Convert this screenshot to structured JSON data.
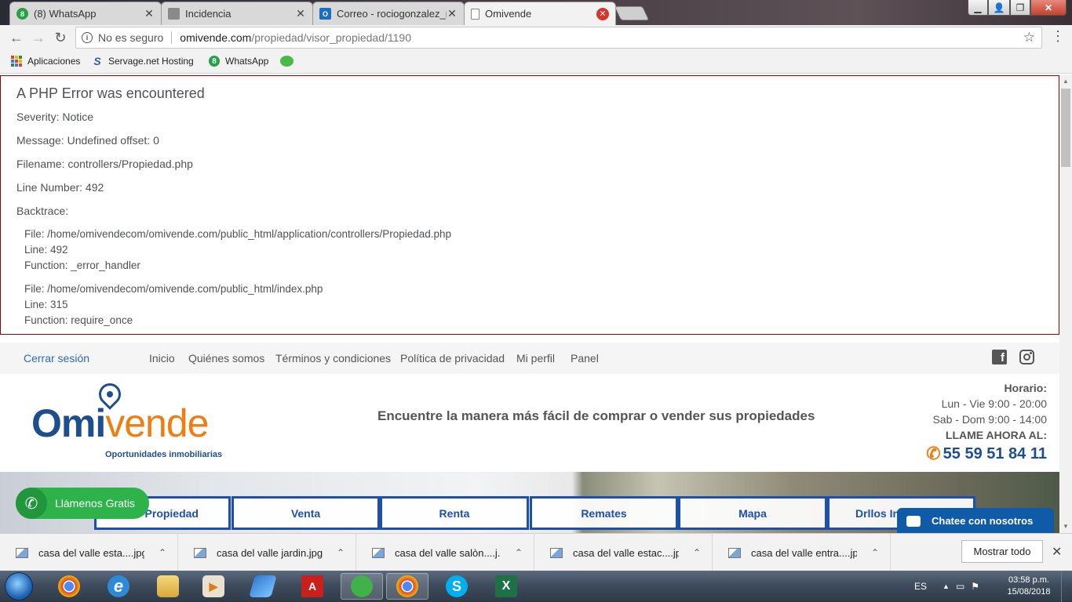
{
  "browser": {
    "tabs": [
      {
        "label": "(8) WhatsApp",
        "icon": "whatsapp-icon",
        "favicon_text": "8"
      },
      {
        "label": "Incidencia",
        "icon": "incidencia-icon",
        "favicon_text": ""
      },
      {
        "label": "Correo - rociogonzalez_m",
        "icon": "outlook-icon",
        "favicon_text": "O"
      },
      {
        "label": "Omivende",
        "icon": "page-icon",
        "favicon_text": ""
      }
    ],
    "address": {
      "secure_label": "No es seguro",
      "host": "omivende.com",
      "path": "/propiedad/visor_propiedad/1190"
    },
    "bookmarks": [
      {
        "label": "Aplicaciones",
        "icon": "apps-grid-icon"
      },
      {
        "label": "Servage.net Hosting",
        "icon": "servage-icon"
      },
      {
        "label": "WhatsApp",
        "icon": "whatsapp-icon"
      },
      {
        "label": "",
        "icon": "wechat-icon"
      }
    ]
  },
  "php_error": {
    "title": "A PHP Error was encountered",
    "severity": "Severity: Notice",
    "message": "Message: Undefined offset: 0",
    "filename": "Filename: controllers/Propiedad.php",
    "line_number": "Line Number: 492",
    "backtrace_label": "Backtrace:",
    "backtrace": [
      {
        "file": "File: /home/omivendecom/omivende.com/public_html/application/controllers/Propiedad.php",
        "line": "Line: 492",
        "function": "Function: _error_handler"
      },
      {
        "file": "File: /home/omivendecom/omivende.com/public_html/index.php",
        "line": "Line: 315",
        "function": "Function: require_once"
      }
    ]
  },
  "site": {
    "logout": "Cerrar sesión",
    "nav": [
      "Inicio",
      "Quiénes somos",
      "Términos y condiciones",
      "Política de privacidad",
      "Mi perfil",
      "Panel"
    ],
    "logo": {
      "omi": "Omi",
      "vende": "vende",
      "tagline": "Oportunidades inmobiliarias"
    },
    "tagline": "Encuentre la manera más fácil de comprar o vender sus propiedades",
    "hours": {
      "label": "Horario:",
      "weekdays": "Lun - Vie 9:00 - 20:00",
      "weekend": "Sab - Dom 9:00 - 14:00",
      "call_label": "LLAME AHORA AL:",
      "phone": "55 59 51 84 11"
    },
    "categories": [
      "Propiedad",
      "Venta",
      "Renta",
      "Remates",
      "Mapa",
      "Drllos Inm"
    ],
    "call_free": "Llámenos Gratis",
    "chat": "Chatee con nosotros",
    "colors": {
      "brand_blue": "#1d4f8e",
      "brand_orange": "#ef7d12",
      "call_green": "#2db34a",
      "chat_blue": "#0f5ba8"
    }
  },
  "downloads": {
    "items": [
      "casa del valle esta....jpg",
      "casa del valle jardin.jpg",
      "casa del valle salòn....j...",
      "casa del valle estac....jpg",
      "casa del valle entra....jpg"
    ],
    "show_all": "Mostrar todo"
  },
  "taskbar": {
    "apps": [
      {
        "name": "chrome-icon",
        "label": ""
      },
      {
        "name": "internet-explorer-icon",
        "label": "e"
      },
      {
        "name": "file-explorer-icon",
        "label": ""
      },
      {
        "name": "media-player-icon",
        "label": "▶"
      },
      {
        "name": "pen-app-icon",
        "label": ""
      },
      {
        "name": "acrobat-icon",
        "label": "A"
      },
      {
        "name": "wechat-icon",
        "label": ""
      },
      {
        "name": "chrome-active-icon",
        "label": ""
      },
      {
        "name": "skype-icon",
        "label": "S"
      },
      {
        "name": "excel-icon",
        "label": "X"
      }
    ],
    "language": "ES",
    "time": "03:58 p.m.",
    "date": "15/08/2018"
  }
}
